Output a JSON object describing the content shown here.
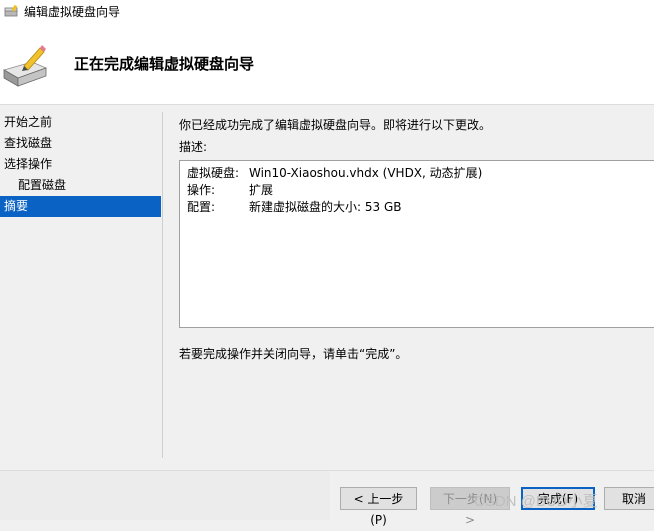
{
  "window": {
    "title": "编辑虚拟硬盘向导"
  },
  "header": {
    "heading": "正在完成编辑虚拟硬盘向导"
  },
  "nav": {
    "items": [
      {
        "label": "开始之前"
      },
      {
        "label": "查找磁盘"
      },
      {
        "label": "选择操作"
      },
      {
        "label": "配置磁盘"
      },
      {
        "label": "摘要",
        "selected": true
      }
    ]
  },
  "content": {
    "intro": "你已经成功完成了编辑虚拟硬盘向导。即将进行以下更改。",
    "description_label": "描述:",
    "summary": [
      {
        "key": "虚拟硬盘:",
        "value": "Win10-Xiaoshou.vhdx (VHDX, 动态扩展)"
      },
      {
        "key": "操作:",
        "value": "扩展"
      },
      {
        "key": "配置:",
        "value": "新建虚拟磁盘的大小: 53 GB"
      }
    ],
    "finish_note": "若要完成操作并关闭向导，请单击“完成”。"
  },
  "buttons": {
    "prev": "< 上一步(P)",
    "next": "下一步(N) >",
    "finish": "完成(F)",
    "cancel": "取消"
  },
  "watermark": "CSDN @BUD小夏"
}
